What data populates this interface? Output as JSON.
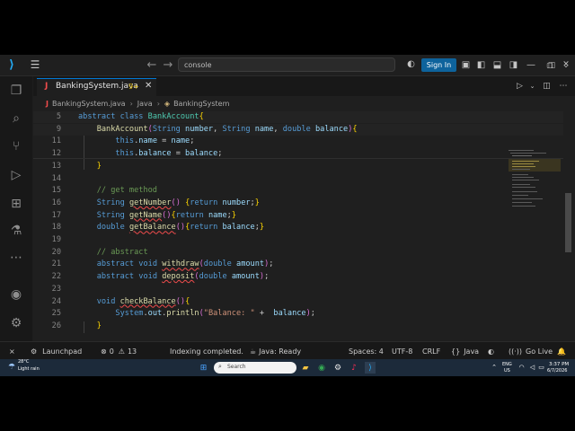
{
  "titlebar": {
    "search_value": "console",
    "signin_label": "Sign In"
  },
  "tab": {
    "java_icon": "J",
    "filename": "BankingSystem.java",
    "badge": "9+"
  },
  "breadcrumb": {
    "items": [
      "BankingSystem.java",
      "Java",
      "BankingSystem"
    ]
  },
  "code": {
    "lines": [
      {
        "n": "5",
        "text": "abstract class BankAccount{"
      },
      {
        "n": "9",
        "text": "    BankAccount(String number, String name, double balance){"
      },
      {
        "n": "11",
        "text": "        this.name = name;"
      },
      {
        "n": "12",
        "text": "        this.balance = balance;"
      },
      {
        "n": "13",
        "text": "    }"
      },
      {
        "n": "14",
        "text": ""
      },
      {
        "n": "15",
        "text": "    // get method"
      },
      {
        "n": "16",
        "text": "    String getNumber() {return number;}"
      },
      {
        "n": "17",
        "text": "    String getName(){return name;}"
      },
      {
        "n": "18",
        "text": "    double getBalance(){return balance;}"
      },
      {
        "n": "19",
        "text": ""
      },
      {
        "n": "20",
        "text": "    // abstract"
      },
      {
        "n": "21",
        "text": "    abstract void withdraw(double amount);"
      },
      {
        "n": "22",
        "text": "    abstract void deposit(double amount);"
      },
      {
        "n": "23",
        "text": ""
      },
      {
        "n": "24",
        "text": "    void checkBalance(){"
      },
      {
        "n": "25",
        "text": "        System.out.println(\"Balance: \" +  balance);"
      },
      {
        "n": "26",
        "text": "    }"
      }
    ]
  },
  "statusbar": {
    "launchpad": "Launchpad",
    "errors": "0",
    "warnings": "13",
    "message": "Indexing completed.",
    "java_status": "Java: Ready",
    "spaces": "Spaces: 4",
    "encoding": "UTF-8",
    "eol": "CRLF",
    "language": "Java",
    "golive": "Go Live"
  },
  "taskbar": {
    "weather_temp": "28°C",
    "weather_cond": "Light rain",
    "search_placeholder": "Search",
    "lang_top": "ENG",
    "lang_bottom": "US",
    "time": "3:37 PM",
    "date": "6/7/2026"
  },
  "colors": {
    "accent": "#0078d4",
    "signin": "#0e639c",
    "keyword": "#569cd6",
    "string": "#ce9178",
    "comment": "#6a9955"
  }
}
